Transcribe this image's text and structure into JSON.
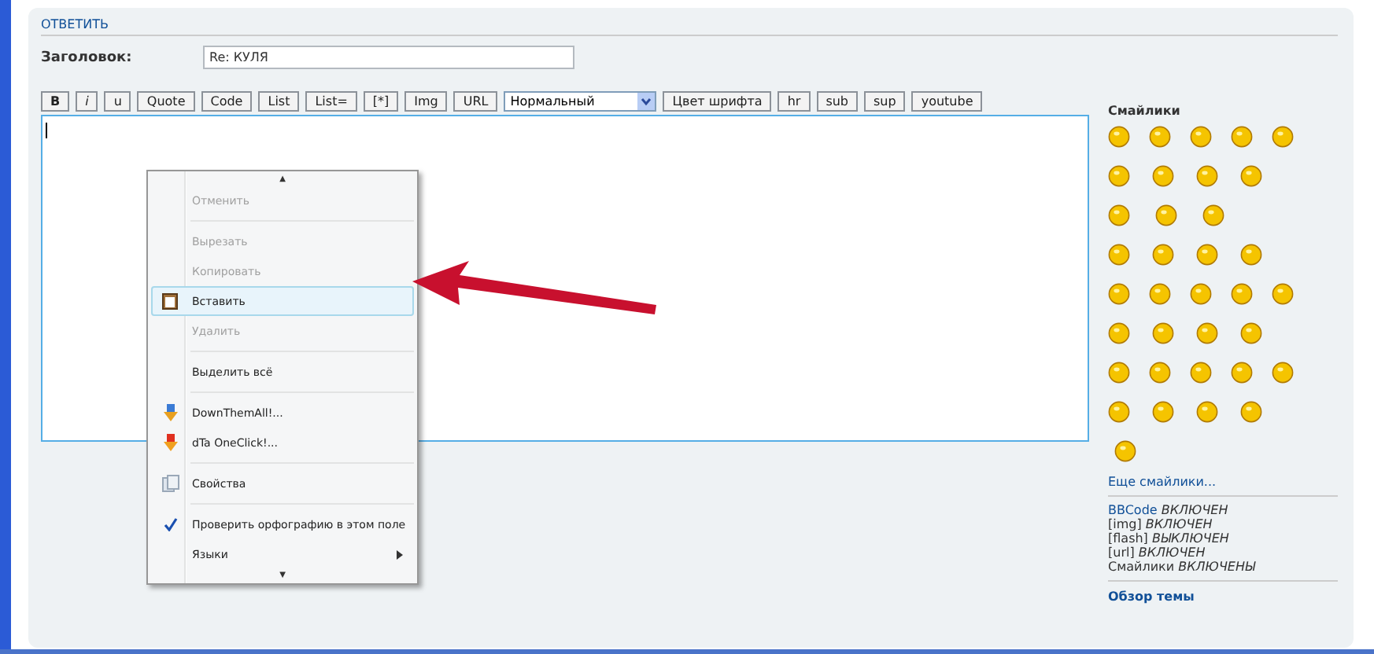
{
  "section_title": "ОТВЕТИТЬ",
  "subject": {
    "label": "Заголовок:",
    "value": "Re: КУЛЯ"
  },
  "toolbar": [
    {
      "kind": "button",
      "label": "B"
    },
    {
      "kind": "button",
      "label": "i"
    },
    {
      "kind": "button",
      "label": "u"
    },
    {
      "kind": "button",
      "label": "Quote"
    },
    {
      "kind": "button",
      "label": "Code"
    },
    {
      "kind": "button",
      "label": "List"
    },
    {
      "kind": "button",
      "label": "List="
    },
    {
      "kind": "button",
      "label": "[*]"
    },
    {
      "kind": "button",
      "label": "Img"
    },
    {
      "kind": "button",
      "label": "URL"
    },
    {
      "kind": "select",
      "label": "Нормальный"
    },
    {
      "kind": "button",
      "label": "Цвет шрифта"
    },
    {
      "kind": "button",
      "label": "hr"
    },
    {
      "kind": "button",
      "label": "sub"
    },
    {
      "kind": "button",
      "label": "sup"
    },
    {
      "kind": "button",
      "label": "youtube"
    }
  ],
  "context_menu": {
    "scroll_up": "▲",
    "scroll_down": "▼",
    "items": [
      {
        "kind": "item",
        "label": "Отменить",
        "disabled": true,
        "selected": false
      },
      {
        "kind": "separator"
      },
      {
        "kind": "item",
        "label": "Вырезать",
        "disabled": true,
        "selected": false
      },
      {
        "kind": "item",
        "label": "Копировать",
        "disabled": true,
        "selected": false
      },
      {
        "kind": "item",
        "label": "Вставить",
        "disabled": false,
        "selected": true
      },
      {
        "kind": "item",
        "label": "Удалить",
        "disabled": true,
        "selected": false
      },
      {
        "kind": "separator"
      },
      {
        "kind": "item",
        "label": "Выделить всё",
        "disabled": false,
        "selected": false
      },
      {
        "kind": "separator"
      },
      {
        "kind": "item",
        "label": "DownThemAll!...",
        "disabled": false,
        "selected": false
      },
      {
        "kind": "item",
        "label": "dTa OneClick!...",
        "disabled": false,
        "selected": false
      },
      {
        "kind": "separator"
      },
      {
        "kind": "item",
        "label": "Свойства",
        "disabled": false,
        "selected": false
      },
      {
        "kind": "separator"
      },
      {
        "kind": "item",
        "label": "Проверить орфографию в этом поле",
        "disabled": false,
        "selected": false,
        "checked": true
      },
      {
        "kind": "item",
        "label": "Языки",
        "disabled": false,
        "selected": false,
        "submenu": true
      }
    ]
  },
  "smileys": {
    "title": "Смайлики",
    "more": "Еще смайлики..."
  },
  "options": [
    {
      "name": "BBCode",
      "state": "ВКЛЮЧЕН",
      "link": true
    },
    {
      "name": "[img]",
      "state": "ВКЛЮЧЕН",
      "link": false
    },
    {
      "name": "[flash]",
      "state": "ВЫКЛЮЧЕН",
      "link": false
    },
    {
      "name": "[url]",
      "state": "ВКЛЮЧЕН",
      "link": false
    },
    {
      "name": "Смайлики",
      "state": "ВКЛЮЧЕНЫ",
      "link": false
    }
  ],
  "topic_review": "Обзор темы"
}
